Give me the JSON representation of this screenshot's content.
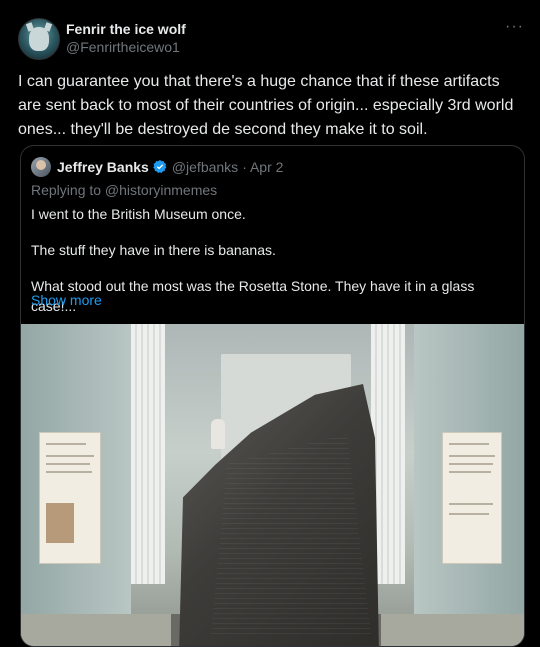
{
  "author": {
    "display_name": "Fenrir the ice wolf",
    "handle": "@Fenrirtheicewo1"
  },
  "menu_icon": "more-horizontal-icon",
  "tweet_text": "I can guarantee you that there's a huge chance that if these artifacts are sent back to most of their countries of origin... especially 3rd world ones... they'll be destroyed de second they make it to soil.",
  "quote": {
    "display_name": "Jeffrey Banks",
    "verified_icon": "verified-badge-icon",
    "handle": "@jefbanks",
    "date": "· Apr 2",
    "replying_to": "Replying to @historyinmemes",
    "paragraphs": [
      "I went to the British Museum once.",
      "The stuff they have in there is bananas.",
      "What stood out the most was the Rosetta Stone. They have it in a glass case!..."
    ],
    "show_more": "Show more",
    "image_subject": "rosetta-stone-photo"
  },
  "colors": {
    "accent": "#1d9bf0",
    "text": "#e7e9ea",
    "muted": "#71767b",
    "background": "#000000"
  }
}
